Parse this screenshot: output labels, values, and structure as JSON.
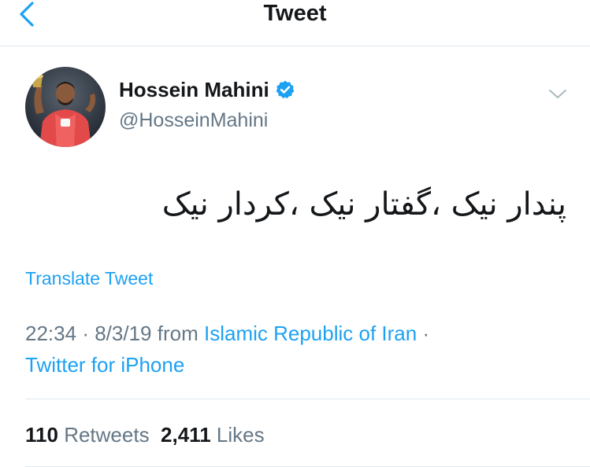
{
  "header": {
    "title": "Tweet",
    "back_icon": "chevron-left-icon"
  },
  "author": {
    "name": "Hossein Mahini",
    "handle": "@HosseinMahini",
    "verified_icon": "verified-badge-icon"
  },
  "tweet": {
    "text": "پندار نیک ،گفتار نیک ،کردار نیک",
    "translate_label": "Translate Tweet",
    "time": "22:34",
    "date": "8/3/19",
    "from_label": "from",
    "location": "Islamic Republic of Iran",
    "client": "Twitter for iPhone",
    "separator": "·"
  },
  "stats": {
    "retweets_count": "110",
    "retweets_label": "Retweets",
    "likes_count": "2,411",
    "likes_label": "Likes"
  },
  "colors": {
    "accent": "#1da1f2",
    "text": "#14171a",
    "muted": "#657786",
    "divider": "#e1e8ed"
  }
}
